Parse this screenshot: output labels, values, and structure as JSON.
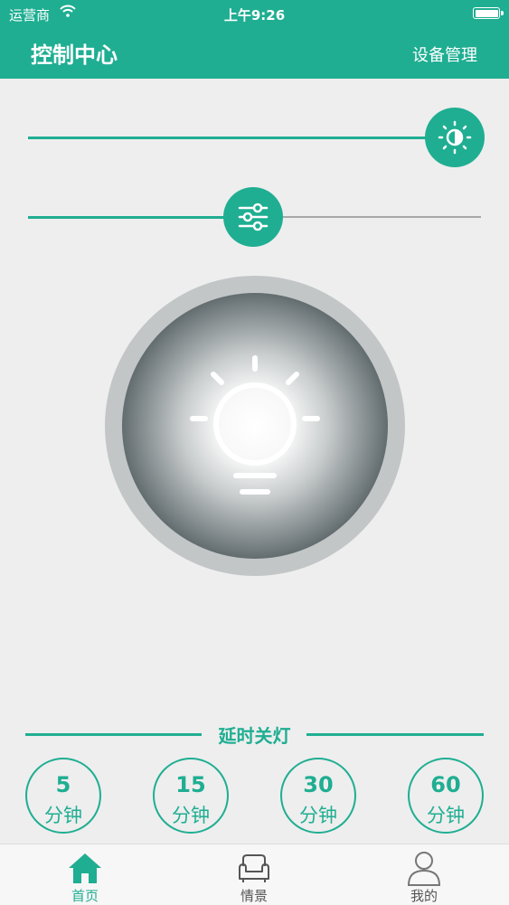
{
  "status": {
    "carrier": "运营商",
    "time": "上午9:26"
  },
  "header": {
    "title": "控制中心",
    "manage_label": "设备管理"
  },
  "brightness": {
    "value": 1.0
  },
  "color_temp": {
    "value": 0.5
  },
  "delay": {
    "title": "延时关灯",
    "options": [
      {
        "num": "5",
        "unit": "分钟"
      },
      {
        "num": "15",
        "unit": "分钟"
      },
      {
        "num": "30",
        "unit": "分钟"
      },
      {
        "num": "60",
        "unit": "分钟"
      }
    ]
  },
  "tabs": [
    {
      "label": "首页",
      "icon": "home-icon",
      "active": true
    },
    {
      "label": "情景",
      "icon": "sofa-icon",
      "active": false
    },
    {
      "label": "我的",
      "icon": "user-icon",
      "active": false
    }
  ],
  "colors": {
    "accent": "#1fae92",
    "inactive": "#555555",
    "track_off": "#a8a8a8"
  }
}
